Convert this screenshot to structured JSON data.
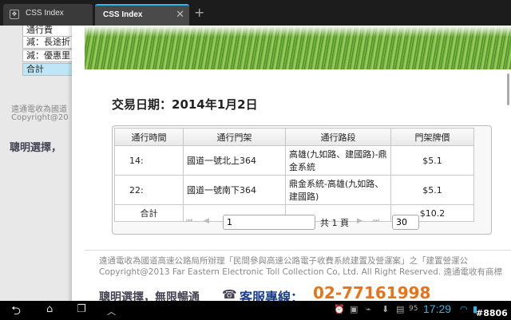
{
  "tabs": [
    {
      "title": "CSS Index",
      "active": false
    },
    {
      "title": "CSS Index",
      "active": true
    }
  ],
  "new_tab_label": "+",
  "left_page": {
    "menu": [
      "通行費",
      "減：長途折",
      "減：優惠里",
      "合計"
    ],
    "footer_lines": [
      "遠通電收為國道",
      "Copyright@20"
    ],
    "slogan": "聰明選擇，"
  },
  "main": {
    "date_label": "交易日期：2014年1月2日",
    "table": {
      "headers": [
        "通行時間",
        "通行門架",
        "通行路段",
        "門架牌價"
      ],
      "rows": [
        {
          "time": "14:",
          "gantry": "國道一號北上364",
          "section": "高雄(九如路、建國路)-鼎金系統",
          "price": "$5.1"
        },
        {
          "time": "22:",
          "gantry": "國道一號南下364",
          "section": "鼎金系統-高雄(九如路、建國路)",
          "price": "$5.1"
        }
      ],
      "total_label": "合計",
      "total_value": "$10.2"
    },
    "pager": {
      "first": "⏮",
      "prev": "◀",
      "next": "▶",
      "last": "⏭",
      "page_value": "1",
      "page_total": "共 1 頁",
      "page_size": "30"
    },
    "footer": {
      "line1": "遠通電收為國道高速公路局所辦理「民間參與高速公路電子收費系統建置及營運案」之「建置營運公",
      "line2": "Copyright@2013 Far Eastern Electronic Toll Collection Co, Ltd. All Right Reserved. 遠通電收有商標"
    },
    "slogan": "聰明選擇，無限暢通",
    "hotline_label": "客服專線：",
    "hotline_number": "02-77161998"
  },
  "status": {
    "battery": "95",
    "time": "17:29",
    "watermark": "#8806"
  },
  "colors": {
    "accent": "#33b5e5",
    "phone": "#e8731a",
    "hotline": "#1b3f8f"
  }
}
